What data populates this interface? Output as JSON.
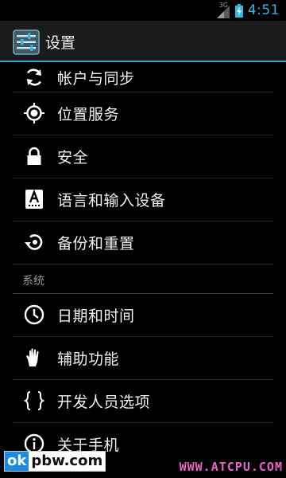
{
  "status_bar": {
    "network_type": "3G",
    "time": "4:51"
  },
  "action_bar": {
    "title": "设置",
    "icon": "settings-app-icon"
  },
  "settings_list": {
    "items_top": [
      {
        "label": "帐户与同步",
        "icon": "sync-icon"
      },
      {
        "label": "位置服务",
        "icon": "location-icon"
      },
      {
        "label": "安全",
        "icon": "lock-icon"
      },
      {
        "label": "语言和输入设备",
        "icon": "keyboard-language-icon"
      },
      {
        "label": "备份和重置",
        "icon": "backup-restore-icon"
      }
    ],
    "section_system": "系统",
    "items_system": [
      {
        "label": "日期和时间",
        "icon": "clock-icon"
      },
      {
        "label": "辅助功能",
        "icon": "hand-icon"
      },
      {
        "label": "开发人员选项",
        "icon": "braces-icon"
      },
      {
        "label": "关于手机",
        "icon": "info-icon"
      }
    ]
  },
  "watermarks": {
    "left_ok": "ok",
    "left_rest": "pbw.com",
    "right": "WWW.ATCPU.COM"
  },
  "colors": {
    "accent": "#33b5e5",
    "action_bar_border": "#2d9fd0",
    "watermark_right": "#ea63c8"
  }
}
